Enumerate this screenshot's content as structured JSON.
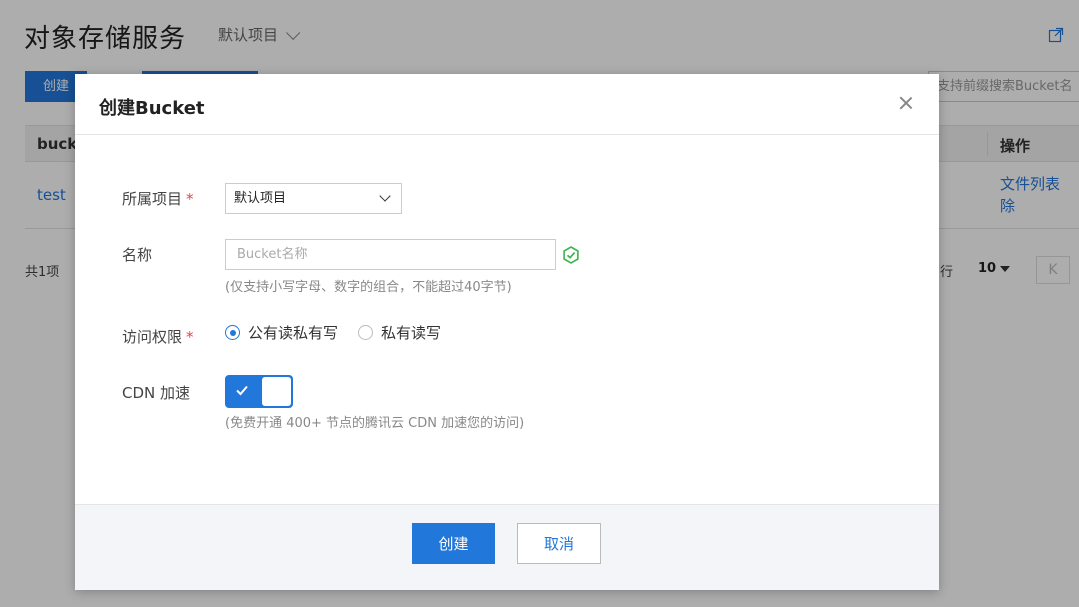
{
  "page": {
    "title": "对象存储服务",
    "project_selector": "默认项目",
    "primary_button": "创建",
    "search_placeholder": "支持前缀搜索Bucket名",
    "table": {
      "col_name": "buck",
      "col_ops": "操作",
      "rows": [
        {
          "name": "test",
          "ops_line1": "文件列表",
          "ops_line2": "除"
        }
      ]
    },
    "total": "共1项",
    "rows_per_page_label": "行",
    "rows_per_page_value": "10",
    "pager_first": "K"
  },
  "modal": {
    "title": "创建Bucket",
    "close_icon": "close-icon",
    "project": {
      "label": "所属项目",
      "required_mark": "*",
      "value": "默认项目"
    },
    "name": {
      "label": "名称",
      "placeholder": "Bucket名称",
      "hint": "(仅支持小写字母、数字的组合，不能超过40字节)",
      "valid_icon": "check-circle-icon"
    },
    "access": {
      "label": "访问权限",
      "required_mark": "*",
      "options": [
        {
          "label": "公有读私有写",
          "checked": true
        },
        {
          "label": "私有读写",
          "checked": false
        }
      ]
    },
    "cdn": {
      "label": "CDN 加速",
      "enabled": true,
      "hint": "(免费开通 400+ 节点的腾讯云 CDN 加速您的访问)"
    },
    "footer": {
      "create": "创建",
      "cancel": "取消"
    }
  },
  "colors": {
    "accent": "#2277da",
    "required": "#e54545",
    "success": "#3bb54a"
  }
}
